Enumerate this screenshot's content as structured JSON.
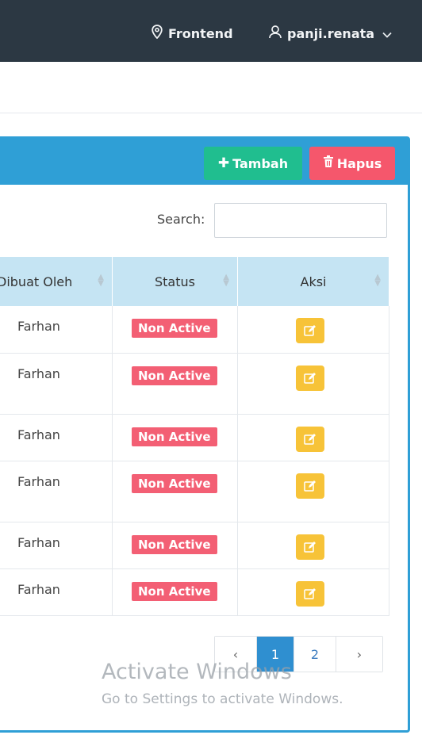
{
  "topbar": {
    "frontend_label": "Frontend",
    "user_label": "panji.renata"
  },
  "panel": {
    "add_label": "Tambah",
    "delete_label": "Hapus"
  },
  "search": {
    "label": "Search:",
    "value": "",
    "placeholder": ""
  },
  "table": {
    "headers": [
      "Dibuat Oleh",
      "Status",
      "Aksi"
    ],
    "rows": [
      {
        "created_by": "Farhan",
        "status": "Non Active"
      },
      {
        "created_by": "Farhan",
        "status": "Non Active"
      },
      {
        "created_by": "Farhan",
        "status": "Non Active"
      },
      {
        "created_by": "Farhan",
        "status": "Non Active"
      },
      {
        "created_by": "Farhan",
        "status": "Non Active"
      },
      {
        "created_by": "Farhan",
        "status": "Non Active"
      }
    ]
  },
  "pagination": {
    "prev": "‹",
    "pages": [
      "1",
      "2"
    ],
    "next": "›",
    "active": "1"
  },
  "watermark": {
    "title": "Activate Windows",
    "subtitle": "Go to Settings to activate Windows."
  },
  "colors": {
    "topbar": "#2c3843",
    "panel": "#2f9fd6",
    "tambah": "#20be8f",
    "hapus": "#f5576c",
    "badge": "#f35f74",
    "edit": "#f7c338"
  },
  "icons": {
    "frontend": "map-pin-icon",
    "user": "user-icon",
    "dropdown": "chevron-down-icon",
    "add": "plus-icon",
    "delete": "trash-icon",
    "edit": "edit-icon",
    "sort": "sort-icon"
  }
}
